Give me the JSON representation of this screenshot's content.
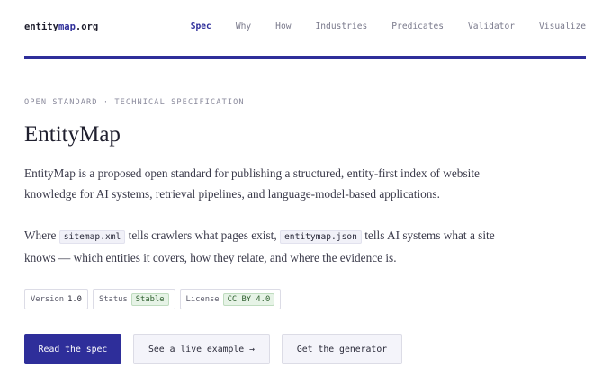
{
  "header": {
    "logo_prefix": "entity",
    "logo_accent": "map",
    "logo_suffix": ".org",
    "nav": [
      {
        "label": "Spec",
        "active": true
      },
      {
        "label": "Why"
      },
      {
        "label": "How"
      },
      {
        "label": "Industries"
      },
      {
        "label": "Predicates"
      },
      {
        "label": "Validator"
      },
      {
        "label": "Visualize"
      }
    ]
  },
  "hero": {
    "eyebrow": "OPEN STANDARD · TECHNICAL SPECIFICATION",
    "title": "EntityMap",
    "intro": "EntityMap is a proposed open standard for publishing a structured, entity-first index of website knowledge for AI systems, retrieval pipelines, and language-model-based applications.",
    "p2_part1": "Where",
    "p2_code1": "sitemap.xml",
    "p2_part2": "tells crawlers what pages exist,",
    "p2_code2": "entitymap.json",
    "p2_part3": "tells AI systems what a site knows — which entities it covers, how they relate, and where the evidence is."
  },
  "badges": [
    {
      "key": "Version",
      "value": "1.0"
    },
    {
      "key": "Status",
      "value": "Stable"
    },
    {
      "key": "License",
      "value": "CC BY 4.0"
    }
  ],
  "buttons": {
    "primary": "Read the spec",
    "secondary": "See a live example →",
    "tertiary": "Get the generator"
  },
  "colors": {
    "accent": "#2e2e9a",
    "badge_green_bg": "#e6f3e6"
  }
}
